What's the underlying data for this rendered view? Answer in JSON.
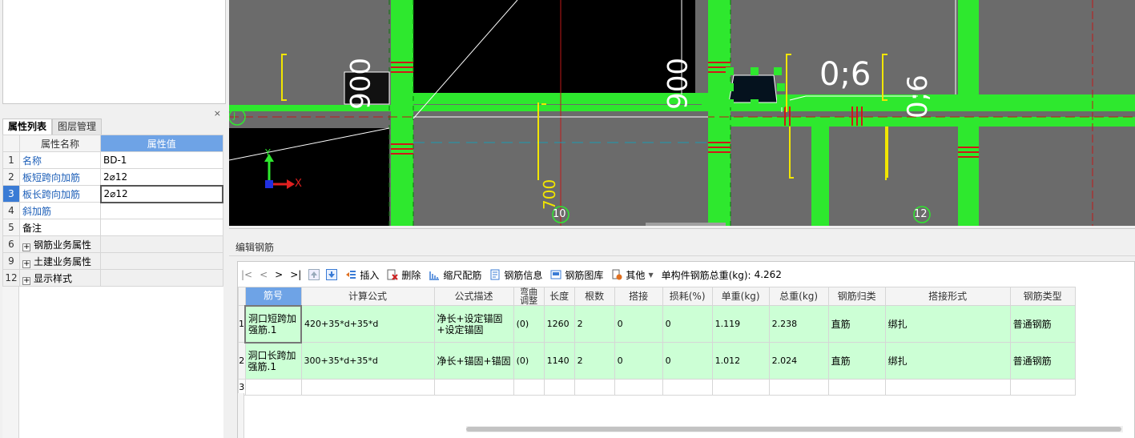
{
  "property_panel": {
    "close_glyph": "×",
    "tabs": [
      {
        "label": "属性列表"
      },
      {
        "label": "图层管理"
      }
    ],
    "headers": {
      "name": "属性名称",
      "value": "属性值"
    },
    "rows": [
      {
        "index": "1",
        "name": "名称",
        "value": "BD-1"
      },
      {
        "index": "2",
        "name": "板短跨向加筋",
        "value": "2⌀12"
      },
      {
        "index": "3",
        "name": "板长跨向加筋",
        "value": "2⌀12"
      },
      {
        "index": "4",
        "name": "斜加筋",
        "value": ""
      },
      {
        "index": "5",
        "name": "备注",
        "value": ""
      },
      {
        "index": "6",
        "name": "钢筋业务属性",
        "value": ""
      },
      {
        "index": "9",
        "name": "土建业务属性",
        "value": ""
      },
      {
        "index": "12",
        "name": "显示样式",
        "value": ""
      }
    ],
    "expander_glyph": "+"
  },
  "cad_canvas": {
    "axis_labels": {
      "y": "Y",
      "x": "X"
    },
    "grid_labels": [
      "J",
      "10",
      "12"
    ],
    "dimension_texts": [
      "0;6",
      "0;6",
      "006",
      "006",
      "700"
    ],
    "colors": {
      "background": "#6b6b6b",
      "wall": "#2ee82e",
      "black_region": "#000000",
      "rebar_red": "#d01818",
      "rebar_yellow": "#f2e600"
    }
  },
  "editor": {
    "title": "编辑钢筋",
    "toolbar": {
      "nav": [
        "|<",
        "<",
        ">",
        ">|"
      ],
      "buttons": [
        {
          "label": "插入",
          "icon": "insert-icon"
        },
        {
          "label": "删除",
          "icon": "delete-icon"
        },
        {
          "label": "缩尺配筋",
          "icon": "scale-rebar-icon"
        },
        {
          "label": "钢筋信息",
          "icon": "rebar-info-icon"
        },
        {
          "label": "钢筋图库",
          "icon": "rebar-library-icon"
        },
        {
          "label": "其他",
          "icon": "other-icon"
        }
      ],
      "summary_label": "单构件钢筋总重(kg):",
      "summary_value": "4.262"
    },
    "columns": [
      "筋号",
      "计算公式",
      "公式描述",
      "弯曲调整",
      "长度",
      "根数",
      "搭接",
      "损耗(%)",
      "单重(kg)",
      "总重(kg)",
      "钢筋归类",
      "搭接形式",
      "钢筋类型"
    ],
    "rows": [
      {
        "no": "1",
        "name": "洞口短跨加强筋.1",
        "formula": "420+35*d+35*d",
        "desc": "净长+设定锚固+设定锚固",
        "bend": "(0)",
        "length": "1260",
        "count": "2",
        "lap": "0",
        "loss": "0",
        "unit_weight": "1.119",
        "total_weight": "2.238",
        "category": "直筋",
        "lap_type": "绑扎",
        "rebar_type": "普通钢筋"
      },
      {
        "no": "2",
        "name": "洞口长跨加强筋.1",
        "formula": "300+35*d+35*d",
        "desc": "净长+锚固+锚固",
        "bend": "(0)",
        "length": "1140",
        "count": "2",
        "lap": "0",
        "loss": "0",
        "unit_weight": "1.012",
        "total_weight": "2.024",
        "category": "直筋",
        "lap_type": "绑扎",
        "rebar_type": "普通钢筋"
      },
      {
        "no": "3",
        "name": "",
        "formula": "",
        "desc": "",
        "bend": "",
        "length": "",
        "count": "",
        "lap": "",
        "loss": "",
        "unit_weight": "",
        "total_weight": "",
        "category": "",
        "lap_type": "",
        "rebar_type": ""
      }
    ]
  }
}
